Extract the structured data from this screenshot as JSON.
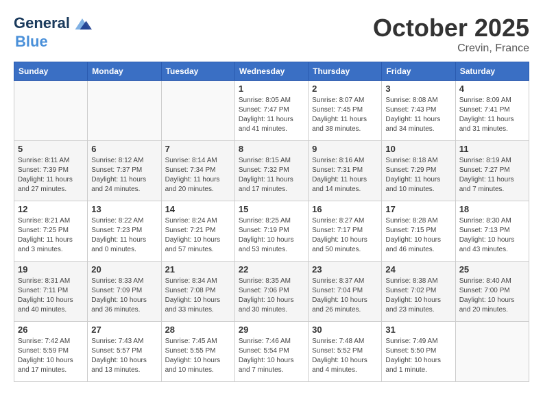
{
  "header": {
    "logo_line1": "General",
    "logo_line2": "Blue",
    "month": "October 2025",
    "location": "Crevin, France"
  },
  "weekdays": [
    "Sunday",
    "Monday",
    "Tuesday",
    "Wednesday",
    "Thursday",
    "Friday",
    "Saturday"
  ],
  "weeks": [
    [
      {
        "day": "",
        "info": ""
      },
      {
        "day": "",
        "info": ""
      },
      {
        "day": "",
        "info": ""
      },
      {
        "day": "1",
        "info": "Sunrise: 8:05 AM\nSunset: 7:47 PM\nDaylight: 11 hours and 41 minutes."
      },
      {
        "day": "2",
        "info": "Sunrise: 8:07 AM\nSunset: 7:45 PM\nDaylight: 11 hours and 38 minutes."
      },
      {
        "day": "3",
        "info": "Sunrise: 8:08 AM\nSunset: 7:43 PM\nDaylight: 11 hours and 34 minutes."
      },
      {
        "day": "4",
        "info": "Sunrise: 8:09 AM\nSunset: 7:41 PM\nDaylight: 11 hours and 31 minutes."
      }
    ],
    [
      {
        "day": "5",
        "info": "Sunrise: 8:11 AM\nSunset: 7:39 PM\nDaylight: 11 hours and 27 minutes."
      },
      {
        "day": "6",
        "info": "Sunrise: 8:12 AM\nSunset: 7:37 PM\nDaylight: 11 hours and 24 minutes."
      },
      {
        "day": "7",
        "info": "Sunrise: 8:14 AM\nSunset: 7:34 PM\nDaylight: 11 hours and 20 minutes."
      },
      {
        "day": "8",
        "info": "Sunrise: 8:15 AM\nSunset: 7:32 PM\nDaylight: 11 hours and 17 minutes."
      },
      {
        "day": "9",
        "info": "Sunrise: 8:16 AM\nSunset: 7:31 PM\nDaylight: 11 hours and 14 minutes."
      },
      {
        "day": "10",
        "info": "Sunrise: 8:18 AM\nSunset: 7:29 PM\nDaylight: 11 hours and 10 minutes."
      },
      {
        "day": "11",
        "info": "Sunrise: 8:19 AM\nSunset: 7:27 PM\nDaylight: 11 hours and 7 minutes."
      }
    ],
    [
      {
        "day": "12",
        "info": "Sunrise: 8:21 AM\nSunset: 7:25 PM\nDaylight: 11 hours and 3 minutes."
      },
      {
        "day": "13",
        "info": "Sunrise: 8:22 AM\nSunset: 7:23 PM\nDaylight: 11 hours and 0 minutes."
      },
      {
        "day": "14",
        "info": "Sunrise: 8:24 AM\nSunset: 7:21 PM\nDaylight: 10 hours and 57 minutes."
      },
      {
        "day": "15",
        "info": "Sunrise: 8:25 AM\nSunset: 7:19 PM\nDaylight: 10 hours and 53 minutes."
      },
      {
        "day": "16",
        "info": "Sunrise: 8:27 AM\nSunset: 7:17 PM\nDaylight: 10 hours and 50 minutes."
      },
      {
        "day": "17",
        "info": "Sunrise: 8:28 AM\nSunset: 7:15 PM\nDaylight: 10 hours and 46 minutes."
      },
      {
        "day": "18",
        "info": "Sunrise: 8:30 AM\nSunset: 7:13 PM\nDaylight: 10 hours and 43 minutes."
      }
    ],
    [
      {
        "day": "19",
        "info": "Sunrise: 8:31 AM\nSunset: 7:11 PM\nDaylight: 10 hours and 40 minutes."
      },
      {
        "day": "20",
        "info": "Sunrise: 8:33 AM\nSunset: 7:09 PM\nDaylight: 10 hours and 36 minutes."
      },
      {
        "day": "21",
        "info": "Sunrise: 8:34 AM\nSunset: 7:08 PM\nDaylight: 10 hours and 33 minutes."
      },
      {
        "day": "22",
        "info": "Sunrise: 8:35 AM\nSunset: 7:06 PM\nDaylight: 10 hours and 30 minutes."
      },
      {
        "day": "23",
        "info": "Sunrise: 8:37 AM\nSunset: 7:04 PM\nDaylight: 10 hours and 26 minutes."
      },
      {
        "day": "24",
        "info": "Sunrise: 8:38 AM\nSunset: 7:02 PM\nDaylight: 10 hours and 23 minutes."
      },
      {
        "day": "25",
        "info": "Sunrise: 8:40 AM\nSunset: 7:00 PM\nDaylight: 10 hours and 20 minutes."
      }
    ],
    [
      {
        "day": "26",
        "info": "Sunrise: 7:42 AM\nSunset: 5:59 PM\nDaylight: 10 hours and 17 minutes."
      },
      {
        "day": "27",
        "info": "Sunrise: 7:43 AM\nSunset: 5:57 PM\nDaylight: 10 hours and 13 minutes."
      },
      {
        "day": "28",
        "info": "Sunrise: 7:45 AM\nSunset: 5:55 PM\nDaylight: 10 hours and 10 minutes."
      },
      {
        "day": "29",
        "info": "Sunrise: 7:46 AM\nSunset: 5:54 PM\nDaylight: 10 hours and 7 minutes."
      },
      {
        "day": "30",
        "info": "Sunrise: 7:48 AM\nSunset: 5:52 PM\nDaylight: 10 hours and 4 minutes."
      },
      {
        "day": "31",
        "info": "Sunrise: 7:49 AM\nSunset: 5:50 PM\nDaylight: 10 hours and 1 minute."
      },
      {
        "day": "",
        "info": ""
      }
    ]
  ]
}
